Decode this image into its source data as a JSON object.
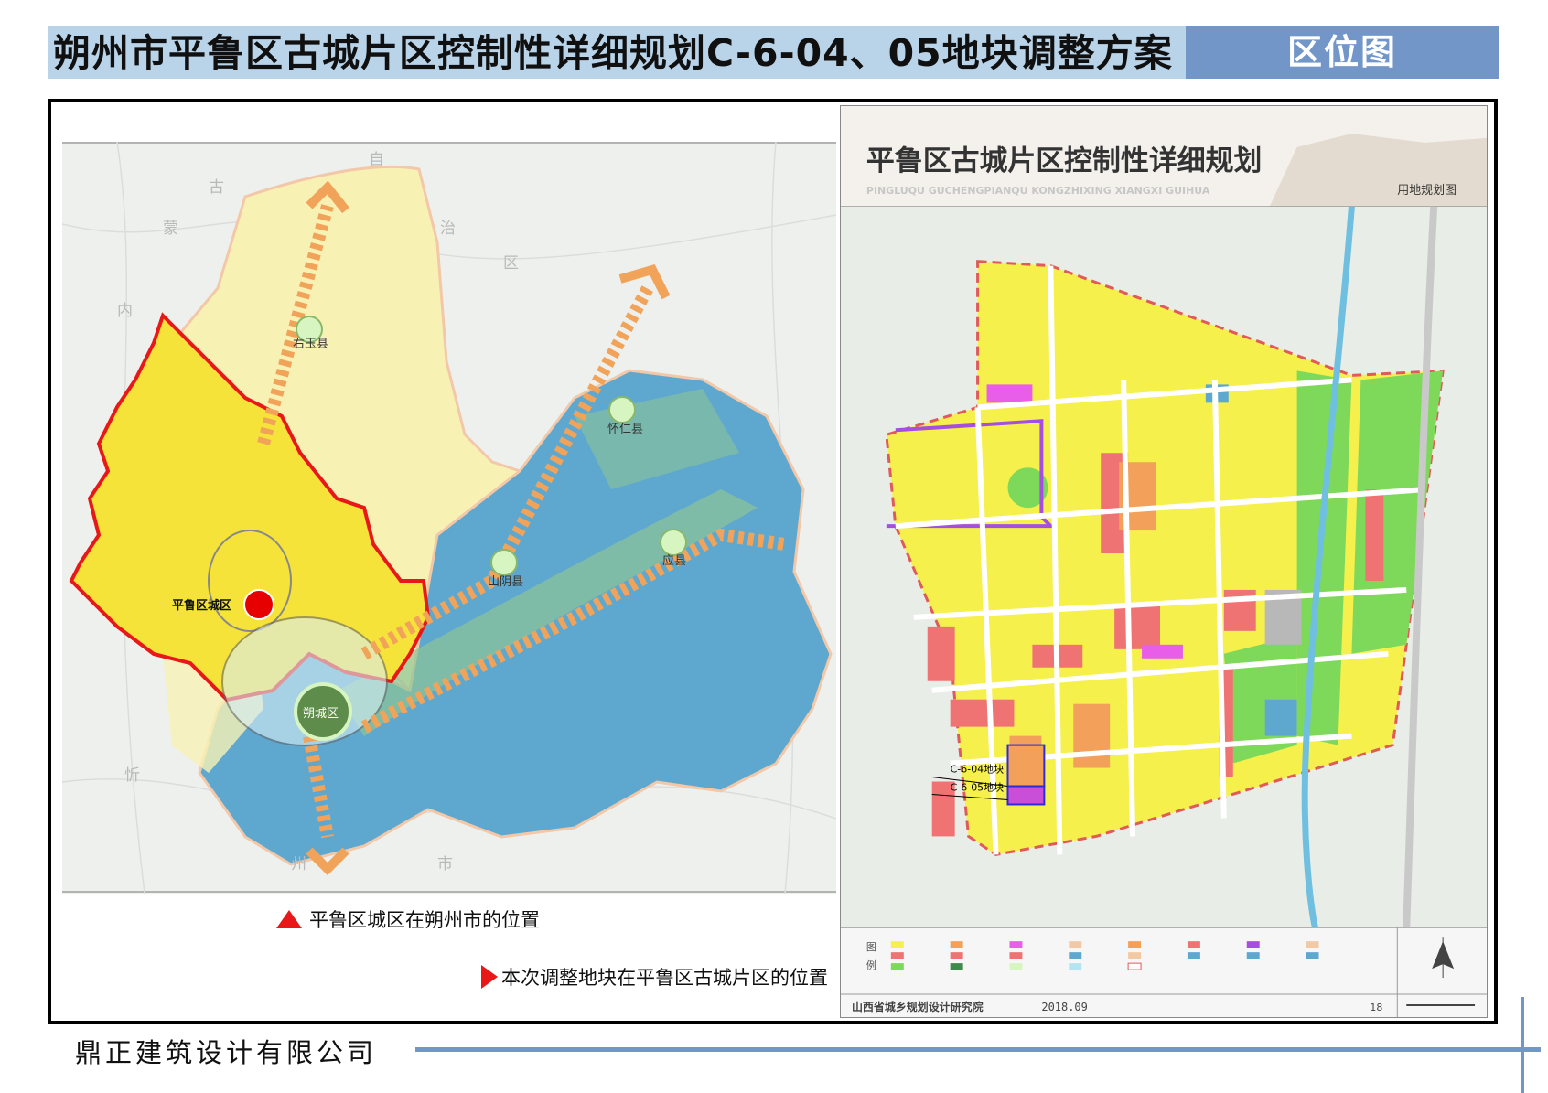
{
  "header": {
    "title": "朔州市平鲁区古城片区控制性详细规划C-6-04、05地块调整方案",
    "section_tab": "区位图"
  },
  "left_map": {
    "place_labels": {
      "pinglu": "平鲁区城区",
      "youyu": "右玉县",
      "huairen": "怀仁县",
      "shanyin": "山阴县",
      "yingxian": "应县",
      "shuocheng": "朔城区"
    },
    "region_chars": [
      "古",
      "蒙",
      "内",
      "自",
      "治",
      "区",
      "忻",
      "州",
      "市"
    ],
    "legend": [
      {
        "label": "平鲁区城区在朔州市的位置",
        "icon": "red-triangle-icon"
      },
      {
        "label": "本次调整地块在平鲁区古城片区的位置",
        "icon": "red-arrow-icon"
      }
    ]
  },
  "right_map": {
    "title": "平鲁区古城片区控制性详细规划",
    "subtitle": "PINGLUQU GUCHENGPIANQU KONGZHIXING XIANGXI GUIHUA",
    "map_type": "用地规划图",
    "plot_labels": [
      "C-6-04地块",
      "C-6-05地块"
    ],
    "legend_title": [
      "图",
      "例"
    ],
    "institute": "山西省城乡规划设计研究院",
    "date": "2018.09",
    "page_no": "18"
  },
  "footer": {
    "company": "鼎正建筑设计有限公司"
  },
  "colors": {
    "title_bar": "#b9d3e9",
    "tab": "#7396c8",
    "residential": "#f5f04c",
    "commercial": "#f07373",
    "green": "#7ed95a",
    "blue_region": "#5ea8d0",
    "highlight": "#e81818"
  }
}
